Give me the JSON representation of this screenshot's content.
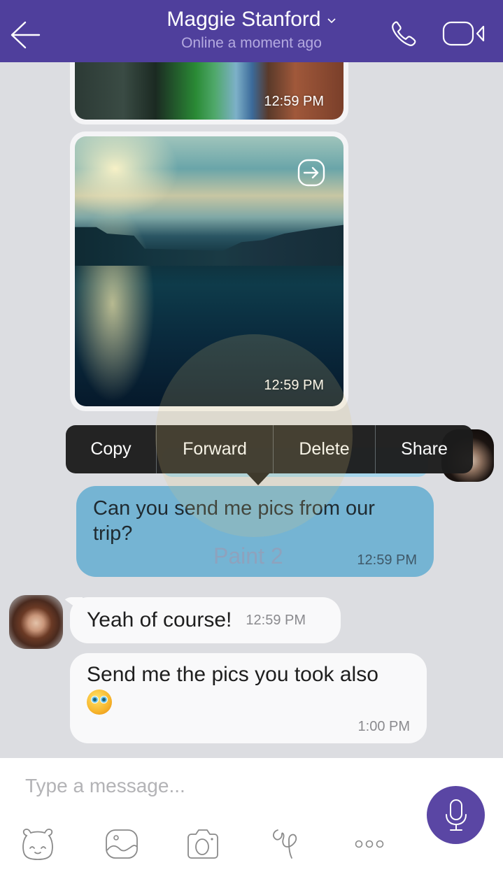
{
  "header": {
    "contact_name": "Maggie Stanford",
    "status": "Online a moment ago",
    "icons": {
      "back": "arrow-left-icon",
      "dropdown": "chevron-down-icon",
      "call": "phone-icon",
      "video": "video-camera-icon"
    }
  },
  "messages": {
    "image1": {
      "time": "12:59 PM"
    },
    "image2": {
      "time": "12:59 PM",
      "forward_icon": "forward-arrow-icon"
    },
    "outgoing1": {
      "text": "Can you send me pics from our trip?",
      "time": "12:59 PM"
    },
    "incoming1": {
      "text": "Yeah of course!",
      "time": "12:59 PM"
    },
    "incoming2": {
      "text": "Send me the pics you took also",
      "emoji": "googly-eyes-smiley",
      "time": "1:00 PM"
    }
  },
  "context_menu": {
    "items": [
      {
        "label": "Copy"
      },
      {
        "label": "Forward"
      },
      {
        "label": "Delete"
      },
      {
        "label": "Share"
      }
    ]
  },
  "watermark": {
    "label": "Paint 2"
  },
  "composer": {
    "placeholder": "Type a message...",
    "value": "",
    "toolbar": [
      "sticker-icon",
      "gallery-icon",
      "camera-icon",
      "doodle-icon",
      "more-icon"
    ],
    "mic_icon": "microphone-icon"
  },
  "colors": {
    "header": "#4f3f9c",
    "outgoing_bubble": "#75b4d3",
    "incoming_bubble": "#f9f9fa",
    "background": "#dcdde1",
    "mic_button": "#5a46a4",
    "context_menu": "#1c1c1c"
  }
}
